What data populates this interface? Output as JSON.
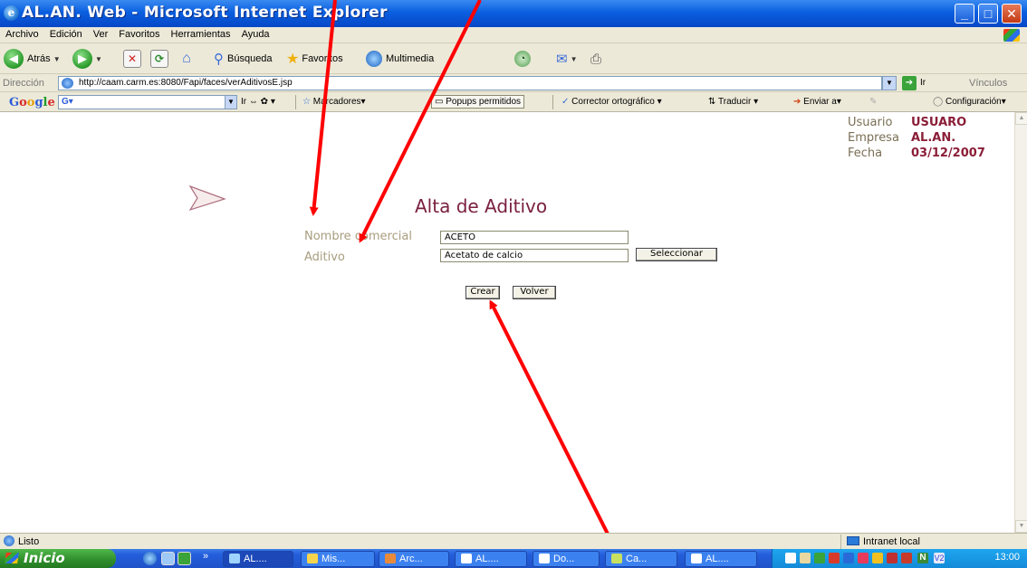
{
  "window": {
    "title": "AL.AN. Web - Microsoft Internet Explorer",
    "min": "_",
    "max": "□",
    "close": "✕"
  },
  "menu": [
    "Archivo",
    "Edición",
    "Ver",
    "Favoritos",
    "Herramientas",
    "Ayuda"
  ],
  "toolbar": {
    "back": "Atrás",
    "search": "Búsqueda",
    "favorites": "Favoritos",
    "multimedia": "Multimedia"
  },
  "address": {
    "label": "Dirección",
    "url": "http://caam.carm.es:8080/Fapi/faces/verAditivosE.jsp",
    "go": "Ir",
    "links": "Vínculos"
  },
  "google": {
    "logo": [
      "G",
      "o",
      "o",
      "g",
      "l",
      "e"
    ],
    "search_value": "G▾",
    "go": "Ir",
    "bookmarks": "Marcadores▾",
    "popups": "Popups permitidos",
    "spell": "Corrector ortográfico ▾",
    "translate": "Traducir ▾",
    "send": "Enviar a▾",
    "settings": "Configuración▾"
  },
  "user_info": {
    "user_label": "Usuario",
    "user_value": "USUARO",
    "company_label": "Empresa",
    "company_value": "AL.AN.",
    "date_label": "Fecha",
    "date_value": "03/12/2007"
  },
  "form": {
    "title": "Alta de Aditivo",
    "nombre_label": "Nombre comercial",
    "nombre_value": "ACETO",
    "aditivo_label": "Aditivo",
    "aditivo_value": "Acetato de calcio",
    "select_button": "Seleccionar",
    "create_button": "Crear",
    "back_button": "Volver"
  },
  "status": {
    "text": "Listo",
    "zone": "Intranet local"
  },
  "taskbar": {
    "start": "Inicio",
    "tasks": [
      "AL....",
      "Mis...",
      "Arc...",
      "AL....",
      "Do...",
      "Ca...",
      "AL...."
    ],
    "clock": "13:00"
  },
  "colors": {
    "title_bar": "#0a5fe0",
    "form_title": "#7a2040",
    "label": "#a89d7e",
    "value_accent": "#8b1e38",
    "annotation_arrow": "#ff0000"
  }
}
